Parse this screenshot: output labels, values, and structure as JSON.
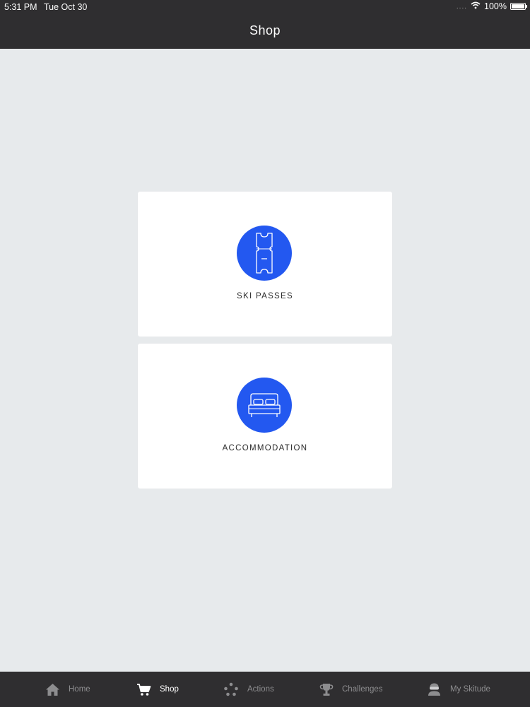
{
  "status_bar": {
    "time": "5:31 PM",
    "date": "Tue Oct 30",
    "signal": "....",
    "battery": "100%",
    "battery_level": 1.0
  },
  "nav": {
    "title": "Shop"
  },
  "shop": {
    "cards": [
      {
        "label": "SKI PASSES",
        "icon": "ticket-icon"
      },
      {
        "label": "ACCOMMODATION",
        "icon": "bed-icon"
      }
    ]
  },
  "tabs": [
    {
      "label": "Home",
      "icon": "home-icon",
      "active": false
    },
    {
      "label": "Shop",
      "icon": "cart-icon",
      "active": true
    },
    {
      "label": "Actions",
      "icon": "dots-icon",
      "active": false
    },
    {
      "label": "Challenges",
      "icon": "trophy-icon",
      "active": false
    },
    {
      "label": "My Skitude",
      "icon": "skier-avatar-icon",
      "active": false
    }
  ],
  "colors": {
    "bar_background": "#2f2e30",
    "page_background": "#e7eaec",
    "accent_blue": "#2358f0",
    "tab_inactive": "#8d8d8f",
    "tab_active": "#ffffff"
  }
}
